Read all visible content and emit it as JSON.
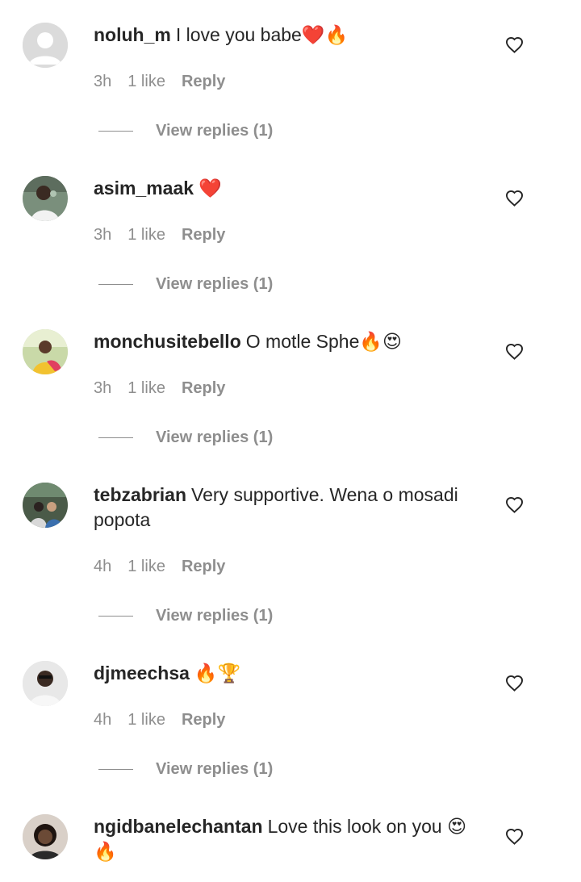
{
  "comments": [
    {
      "username": "noluh_m",
      "text": "I love you babe❤️🔥",
      "time": "3h",
      "likes": "1 like",
      "reply_label": "Reply",
      "view_replies": "View replies (1)",
      "avatar": "default-avatar"
    },
    {
      "username": "asim_maak",
      "text": "❤️",
      "time": "3h",
      "likes": "1 like",
      "reply_label": "Reply",
      "view_replies": "View replies (1)",
      "avatar": "photo-avatar"
    },
    {
      "username": "monchusitebello",
      "text": "O motle Sphe🔥😍",
      "time": "3h",
      "likes": "1 like",
      "reply_label": "Reply",
      "view_replies": "View replies (1)",
      "avatar": "photo-avatar"
    },
    {
      "username": "tebzabrian",
      "text": "Very supportive. Wena o mosadi popota",
      "time": "4h",
      "likes": "1 like",
      "reply_label": "Reply",
      "view_replies": "View replies (1)",
      "avatar": "photo-avatar"
    },
    {
      "username": "djmeechsa",
      "text": "🔥🏆",
      "time": "4h",
      "likes": "1 like",
      "reply_label": "Reply",
      "view_replies": "View replies (1)",
      "avatar": "photo-avatar"
    },
    {
      "username": "ngidbanelechantan",
      "text": "Love this look on you 😍 🔥",
      "avatar": "photo-avatar"
    }
  ],
  "colors": {
    "text": "#262626",
    "muted": "#8e8e8e",
    "background": "#ffffff"
  },
  "icons": {
    "like": "heart-outline-icon"
  }
}
